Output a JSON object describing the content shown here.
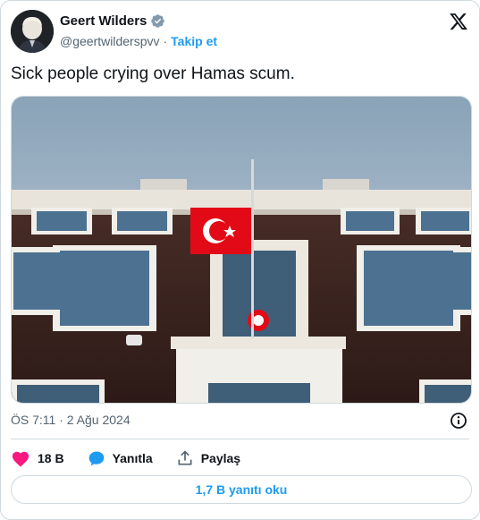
{
  "author": {
    "name": "Geert Wilders",
    "handle": "@geertwilderspvv",
    "separator": "·",
    "follow_label": "Takip et",
    "verified_icon": "verified-badge-icon"
  },
  "tweet": {
    "text": "Sick people crying over Hamas scum.",
    "timestamp": "ÖS 7:11 · 2 Ağu 2024"
  },
  "actions": {
    "like_count": "18 B",
    "reply_label": "Yanıtla",
    "share_label": "Paylaş"
  },
  "read_replies_label": "1,7 B yanıtı oku",
  "colors": {
    "accent": "#1d9bf0",
    "like": "#f91880",
    "text": "#0f1419",
    "secondary": "#536471",
    "border": "#cfd9de",
    "flag_red": "#e30a17"
  },
  "icons": [
    "x-logo-icon",
    "info-icon",
    "heart-icon",
    "reply-bubble-icon",
    "share-icon"
  ]
}
